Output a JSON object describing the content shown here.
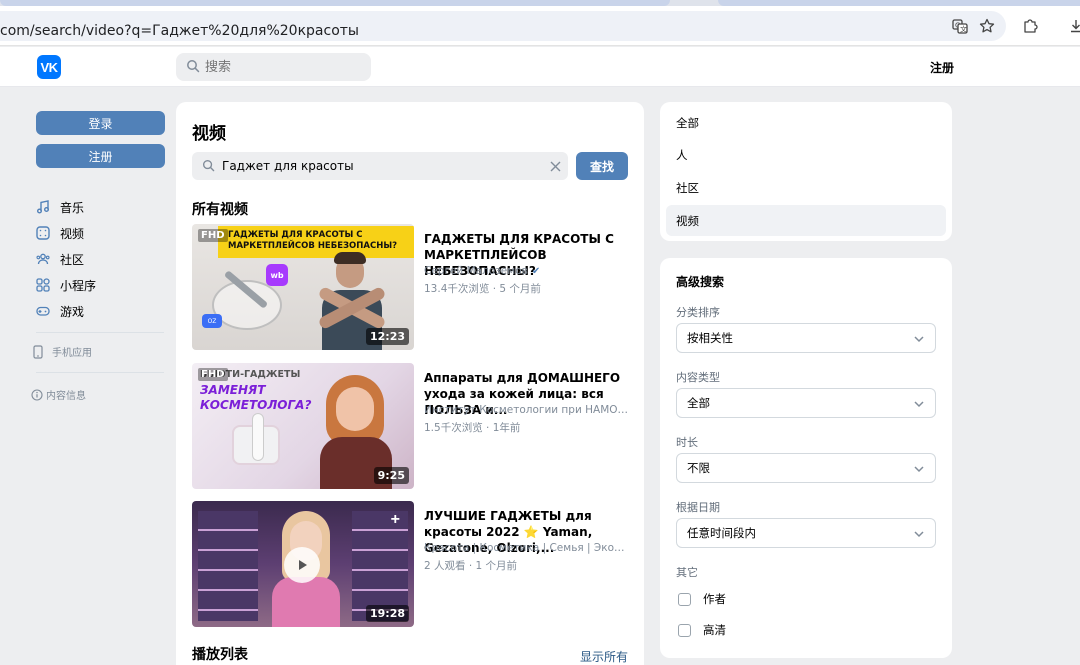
{
  "browser": {
    "url": "com/search/video?q=Гаджет%20для%20красоты"
  },
  "header": {
    "logo": "VK",
    "search_placeholder": "搜索",
    "register": "注册"
  },
  "left": {
    "login_button": "登录",
    "register_button": "注册",
    "nav": [
      {
        "label": "音乐",
        "icon": "music-note-icon"
      },
      {
        "label": "视频",
        "icon": "video-icon"
      },
      {
        "label": "社区",
        "icon": "community-icon"
      },
      {
        "label": "小程序",
        "icon": "apps-grid-icon"
      },
      {
        "label": "游戏",
        "icon": "gamepad-icon"
      }
    ],
    "mobile_app": "手机应用",
    "content_info": "内容信息"
  },
  "main": {
    "title": "视频",
    "query": "Гаджет для красоты",
    "find_button": "查找",
    "all_videos": "所有视频",
    "videos": [
      {
        "title": "ГАДЖЕТЫ ДЛЯ КРАСОТЫ С МАРКЕТПЛЕЙСОВ НЕБЕЗОПАСНЫ?",
        "author": "Сергей Малоземов",
        "verified": true,
        "meta": "13.4千次浏览 · 5 个月前",
        "duration": "12:23",
        "badge": "FHD",
        "thumb_text": "ГАДЖЕТЫ ДЛЯ КРАСОТЫ С МАРКЕТПЛЕЙСОВ НЕБЕЗОПАСНЫ?"
      },
      {
        "title": "Аппараты для ДОМАШНЕГО ухода за кожей лица: вся ПОЛЬЗА и...",
        "author": "Институт Косметологии при НАМО и...",
        "verified": false,
        "meta": "1.5千次浏览 · 1年前",
        "duration": "9:25",
        "badge": "FHD",
        "thumb_text": "БЬЮТИ-ГАДЖЕТЫ",
        "thumb_text2": "ЗАМЕНЯТ КОСМЕТОЛОГА?"
      },
      {
        "title": "ЛУЧШИЕ ГАДЖЕТЫ для красоты 2022 ⭐ Yaman, Gezatone, Olzori,...",
        "author": "Красота | Косметика | Семья | Эконо...",
        "verified": false,
        "meta": "2 人观看 · 1 个月前",
        "duration": "19:28",
        "badge": "",
        "thumb_text": ""
      }
    ],
    "playlists": "播放列表",
    "show_all": "显示所有"
  },
  "filters": {
    "items": [
      "全部",
      "人",
      "社区",
      "视频"
    ],
    "active_index": 3
  },
  "advanced": {
    "title": "高级搜索",
    "sort_label": "分类排序",
    "sort_value": "按相关性",
    "type_label": "内容类型",
    "type_value": "全部",
    "duration_label": "时长",
    "duration_value": "不限",
    "date_label": "根据日期",
    "date_value": "任意时间段内",
    "other_label": "其它",
    "checkbox_author": "作者",
    "checkbox_hd": "高清"
  },
  "colors": {
    "accent": "#5181b8",
    "vk_blue": "#0077ff",
    "background": "#edeef0"
  }
}
